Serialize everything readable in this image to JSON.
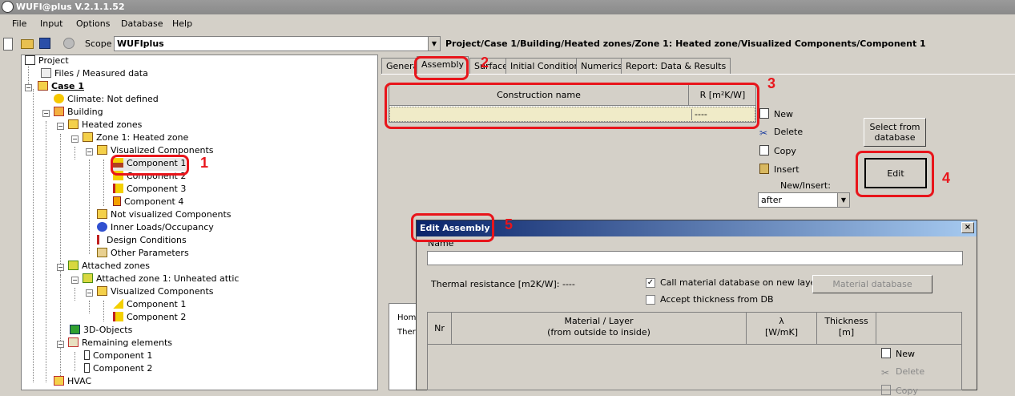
{
  "window": {
    "title": "WUFI@plus V.2.1.1.52"
  },
  "menu": [
    "File",
    "Input",
    "Options",
    "Database",
    "Help"
  ],
  "toolbar": {
    "scope_label": "Scope",
    "scope_value": "WUFIplus",
    "path": "Project/Case 1/Building/Heated zones/Zone 1: Heated zone/Visualized Components/Component 1"
  },
  "tree": [
    {
      "label": "Project",
      "icon": "project-icon"
    },
    {
      "label": "Files / Measured data",
      "icon": "files-icon"
    },
    {
      "label": "Case 1",
      "icon": "case-icon"
    },
    {
      "label": "Climate: Not defined",
      "icon": "climate-icon"
    },
    {
      "label": "Building",
      "icon": "building-icon"
    },
    {
      "label": "Heated zones",
      "icon": "house-icon"
    },
    {
      "label": "Zone 1: Heated zone",
      "icon": "house-icon"
    },
    {
      "label": "Visualized Components",
      "icon": "house-icon"
    },
    {
      "label": "Component 1",
      "icon": "component-icon"
    },
    {
      "label": "Component 2",
      "icon": "component-icon"
    },
    {
      "label": "Component 3",
      "icon": "component-icon"
    },
    {
      "label": "Component 4",
      "icon": "window-component-icon"
    },
    {
      "label": "Not visualized Components",
      "icon": "house-icon"
    },
    {
      "label": "Inner Loads/Occupancy",
      "icon": "loads-icon"
    },
    {
      "label": "Design Conditions",
      "icon": "thermometer-icon"
    },
    {
      "label": "Other Parameters",
      "icon": "parameters-icon"
    },
    {
      "label": "Attached zones",
      "icon": "house-icon"
    },
    {
      "label": "Attached zone 1: Unheated attic",
      "icon": "attic-icon"
    },
    {
      "label": "Visualized Components",
      "icon": "house-icon"
    },
    {
      "label": "Component 1",
      "icon": "roof-component-icon"
    },
    {
      "label": "Component 2",
      "icon": "component-icon"
    },
    {
      "label": "3D-Objects",
      "icon": "objects-icon"
    },
    {
      "label": "Remaining elements",
      "icon": "elements-icon"
    },
    {
      "label": "Component 1",
      "icon": "door-icon"
    },
    {
      "label": "Component 2",
      "icon": "door-icon"
    },
    {
      "label": "HVAC",
      "icon": "hvac-icon"
    }
  ],
  "tabs": [
    "General",
    "Assembly",
    "Surface",
    "Initial Conditions",
    "Numerics",
    "Report: Data & Results"
  ],
  "assembly_grid": {
    "col_name": "Construction name",
    "col_r": "R [m²K/W]",
    "row_r": "----"
  },
  "side_buttons": {
    "new": "New",
    "delete": "Delete",
    "copy": "Copy",
    "insert": "Insert",
    "new_insert_label": "New/Insert:",
    "new_insert_value": "after"
  },
  "buttons": {
    "select_db": "Select from database",
    "edit": "Edit"
  },
  "lower_box": [
    "Hom",
    "Ther"
  ],
  "dialog": {
    "title": "Edit Assembly",
    "close": "×",
    "name_label": "Name",
    "thermal_resistance": "Thermal resistance  [m2K/W]: ----",
    "call_db_label": "Call material database on new layer",
    "call_db_checked": true,
    "accept_thickness_label": "Accept thickness from DB",
    "accept_thickness_checked": false,
    "material_db_button": "Material database",
    "columns": {
      "nr": "Nr",
      "material": "Material / Layer",
      "material_sub": "(from outside to inside)",
      "lambda": "λ",
      "lambda_unit": "[W/mK]",
      "thickness": "Thickness",
      "thickness_unit": "[m]"
    },
    "layer_buttons": {
      "new": "New",
      "delete": "Delete",
      "copy": "Copy"
    }
  },
  "annotations": [
    "1",
    "2",
    "3",
    "4",
    "5"
  ],
  "colors": {
    "annotation": "#e8151b",
    "grid_row": "#f0ebc8",
    "title_gradient_start": "#0a246a"
  }
}
